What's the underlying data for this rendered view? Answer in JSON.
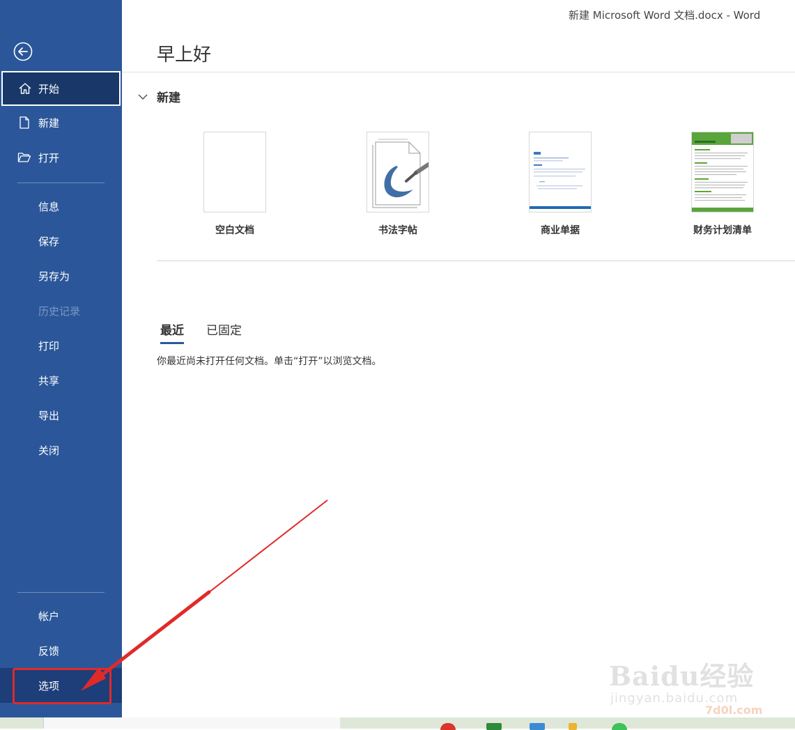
{
  "window": {
    "title": "新建 Microsoft Word 文档.docx  -  Word"
  },
  "sidebar": {
    "back_icon": "back-arrow-icon",
    "items": [
      {
        "label": "开始",
        "icon": "home-icon",
        "state": "active"
      },
      {
        "label": "新建",
        "icon": "new-document-icon"
      },
      {
        "label": "打开",
        "icon": "folder-open-icon"
      },
      {
        "label": "信息"
      },
      {
        "label": "保存"
      },
      {
        "label": "另存为"
      },
      {
        "label": "历史记录",
        "state": "disabled"
      },
      {
        "label": "打印"
      },
      {
        "label": "共享"
      },
      {
        "label": "导出"
      },
      {
        "label": "关闭"
      },
      {
        "label": "帐户"
      },
      {
        "label": "反馈"
      },
      {
        "label": "选项",
        "state": "highlighted"
      }
    ]
  },
  "main": {
    "greeting": "早上好",
    "new_section": {
      "title": "新建",
      "templates": [
        {
          "name": "空白文档"
        },
        {
          "name": "书法字帖"
        },
        {
          "name": "商业单据"
        },
        {
          "name": "财务计划清单"
        }
      ]
    },
    "tabs": [
      {
        "label": "最近",
        "active": true
      },
      {
        "label": "已固定",
        "active": false
      }
    ],
    "empty_message": "你最近尚未打开任何文档。单击“打开”以浏览文档。"
  },
  "colors": {
    "sidebar": "#2b579a",
    "sidebar_active": "#193869",
    "annotation": "#e02a2a",
    "accent": "#2b579a",
    "template_green": "#5aa53b"
  },
  "watermark": {
    "logo": "Baidu经验",
    "url": "jingyan.baidu.com",
    "site": "7d0l.com"
  }
}
